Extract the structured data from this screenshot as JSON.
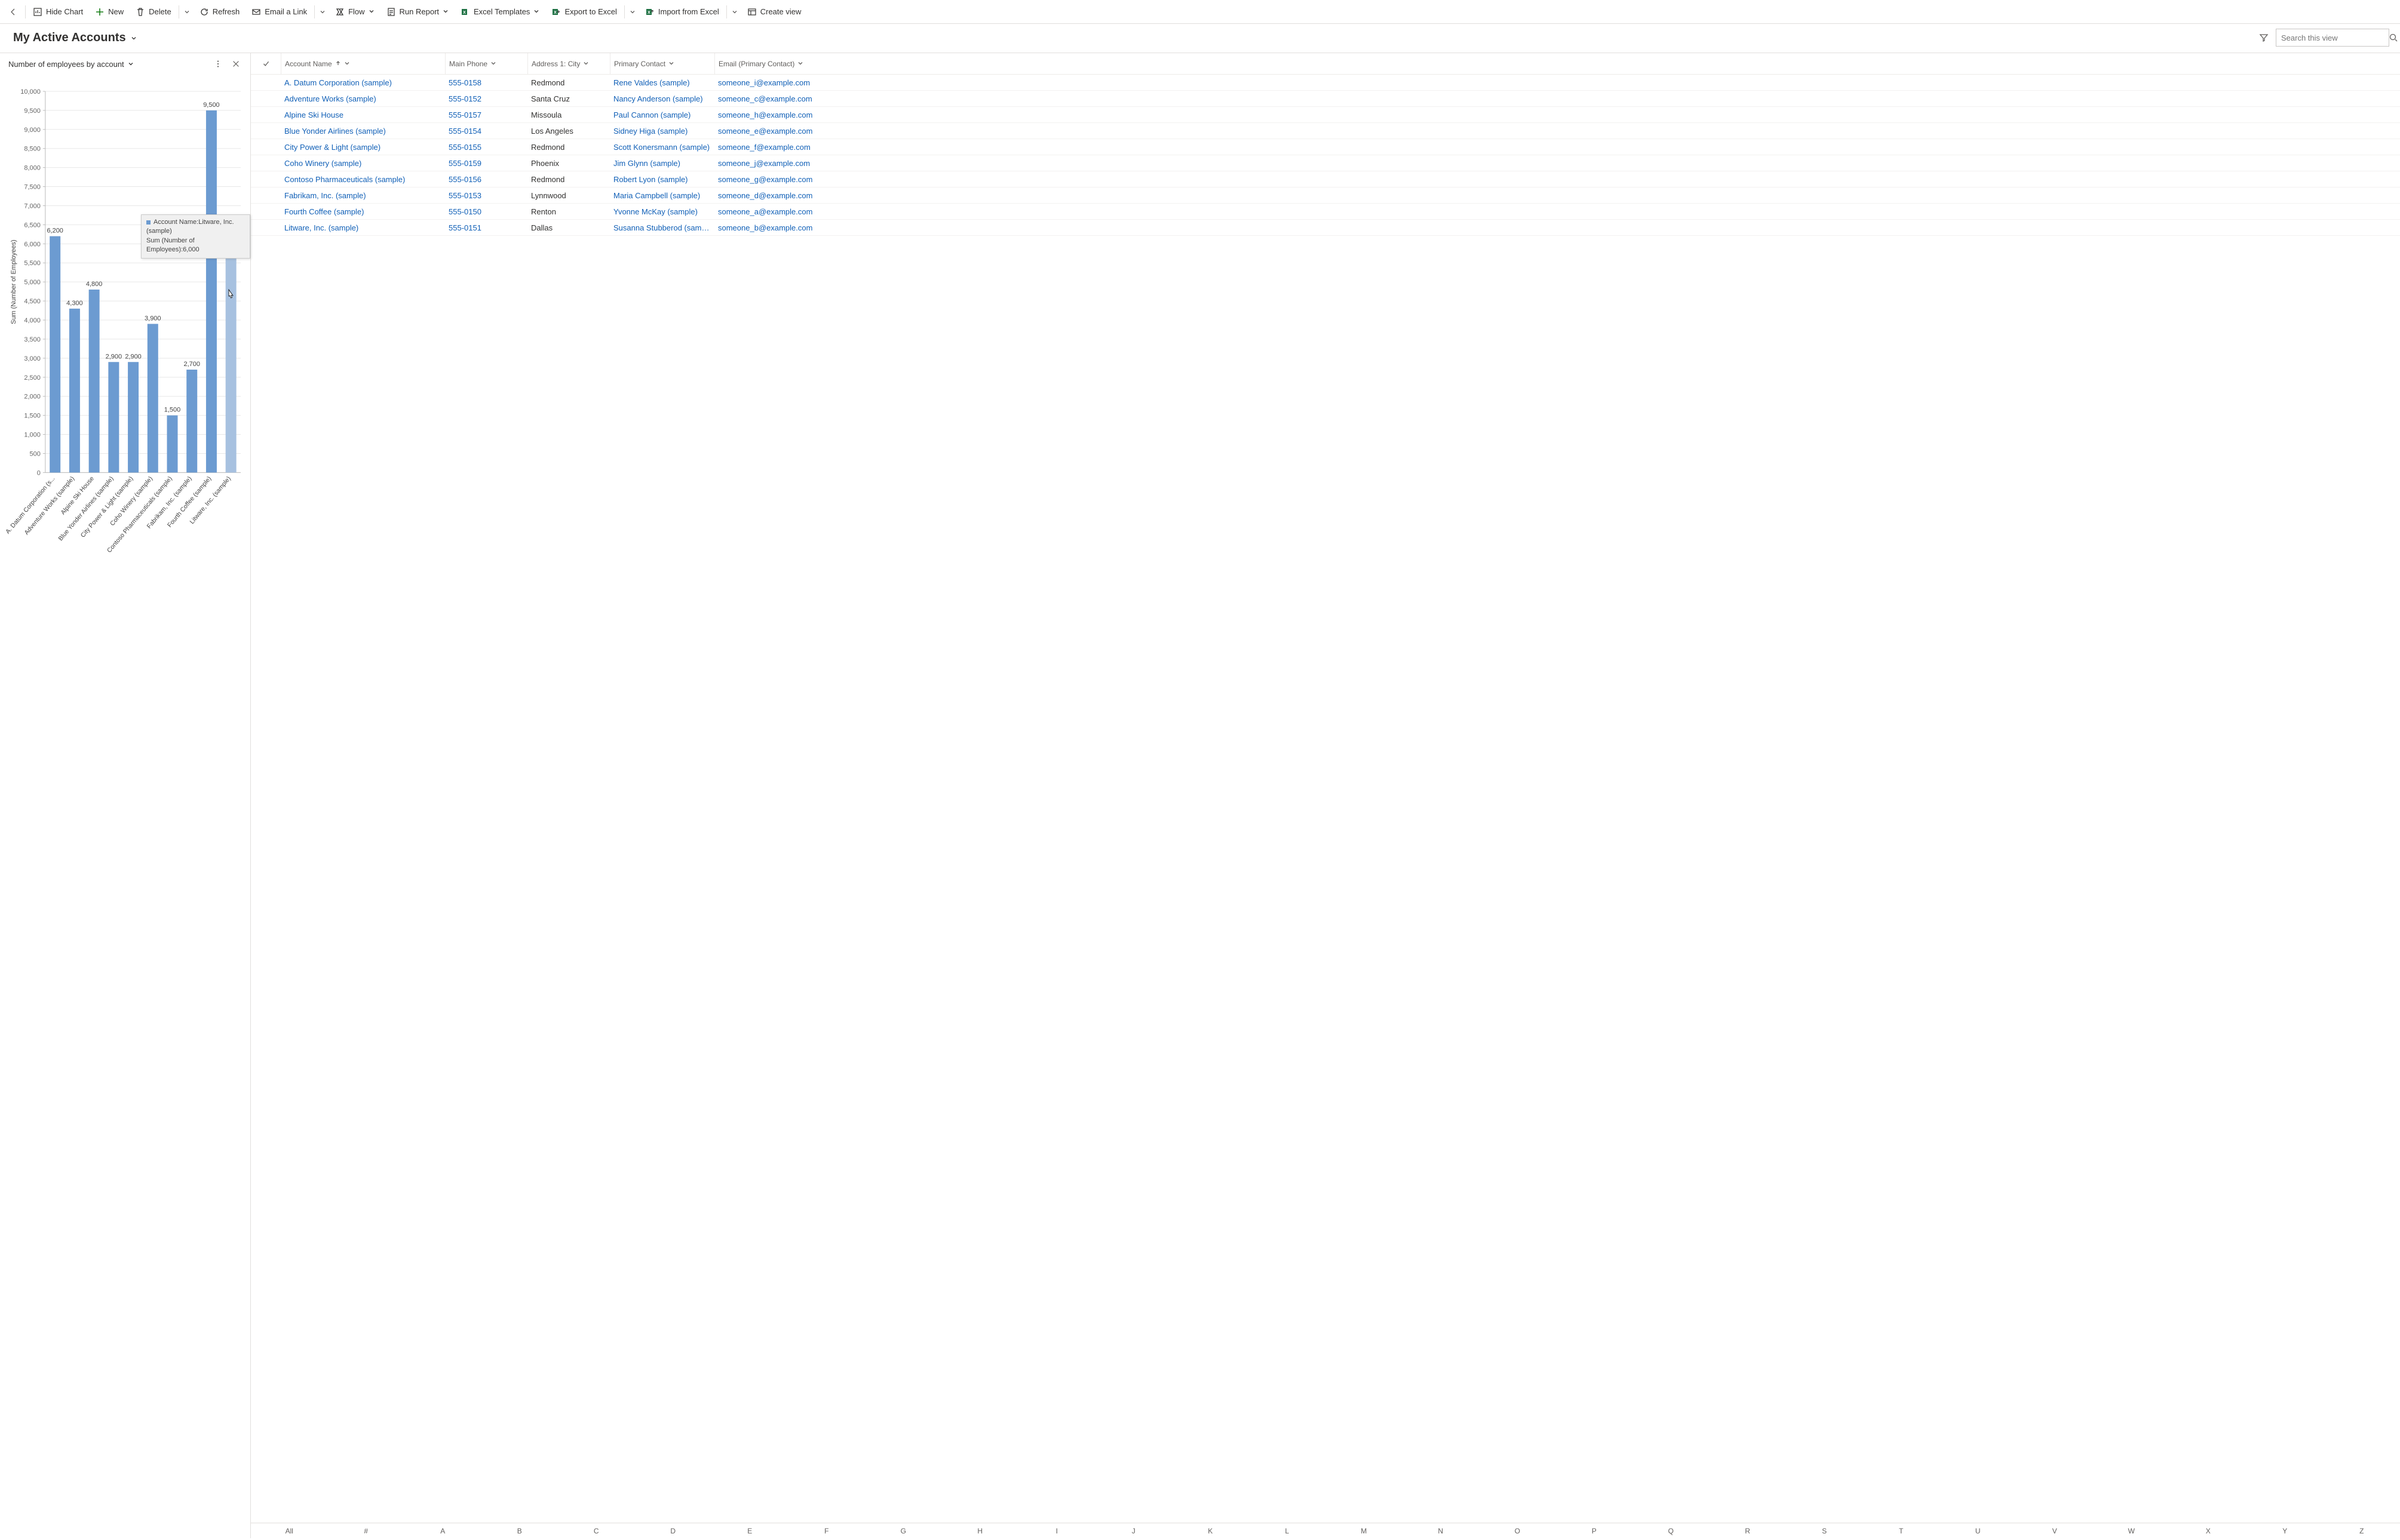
{
  "toolbar": {
    "hide_chart": "Hide Chart",
    "new": "New",
    "delete": "Delete",
    "refresh": "Refresh",
    "email_link": "Email a Link",
    "flow": "Flow",
    "run_report": "Run Report",
    "excel_templates": "Excel Templates",
    "export_excel": "Export to Excel",
    "import_excel": "Import from Excel",
    "create_view": "Create view"
  },
  "view": {
    "title": "My Active Accounts",
    "search_placeholder": "Search this view"
  },
  "chart": {
    "title": "Number of employees by account",
    "tooltip_line1": "Account Name:Litware, Inc. (sample)",
    "tooltip_line2": "Sum (Number of Employees):6,000"
  },
  "chart_data": {
    "type": "bar",
    "ylabel": "Sum (Number of Employees)",
    "ylim": [
      0,
      10000
    ],
    "ytick_step": 500,
    "categories": [
      "A. Datum Corporation (s...",
      "Adventure Works (sample)",
      "Alpine Ski House",
      "Blue Yonder Airlines (sample)",
      "City Power & Light (sample)",
      "Coho Winery (sample)",
      "Contoso Pharmaceuticals (sample)",
      "Fabrikam, Inc. (sample)",
      "Fourth Coffee (sample)",
      "Litware, Inc. (sample)"
    ],
    "values": [
      6200,
      4300,
      4800,
      2900,
      2900,
      3900,
      1500,
      2700,
      9500,
      6000
    ],
    "value_labels": [
      "6,200",
      "4,300",
      "4,800",
      "2,900",
      "2,900",
      "3,900",
      "1,500",
      "2,700",
      "9,500",
      "6,000"
    ],
    "hover_index": 9
  },
  "columns": {
    "name": "Account Name",
    "phone": "Main Phone",
    "city": "Address 1: City",
    "contact": "Primary Contact",
    "email": "Email (Primary Contact)"
  },
  "rows": [
    {
      "name": "A. Datum Corporation (sample)",
      "phone": "555-0158",
      "city": "Redmond",
      "contact": "Rene Valdes (sample)",
      "email": "someone_i@example.com"
    },
    {
      "name": "Adventure Works (sample)",
      "phone": "555-0152",
      "city": "Santa Cruz",
      "contact": "Nancy Anderson (sample)",
      "email": "someone_c@example.com"
    },
    {
      "name": "Alpine Ski House",
      "phone": "555-0157",
      "city": "Missoula",
      "contact": "Paul Cannon (sample)",
      "email": "someone_h@example.com"
    },
    {
      "name": "Blue Yonder Airlines (sample)",
      "phone": "555-0154",
      "city": "Los Angeles",
      "contact": "Sidney Higa (sample)",
      "email": "someone_e@example.com"
    },
    {
      "name": "City Power & Light (sample)",
      "phone": "555-0155",
      "city": "Redmond",
      "contact": "Scott Konersmann (sample)",
      "email": "someone_f@example.com"
    },
    {
      "name": "Coho Winery (sample)",
      "phone": "555-0159",
      "city": "Phoenix",
      "contact": "Jim Glynn (sample)",
      "email": "someone_j@example.com"
    },
    {
      "name": "Contoso Pharmaceuticals (sample)",
      "phone": "555-0156",
      "city": "Redmond",
      "contact": "Robert Lyon (sample)",
      "email": "someone_g@example.com"
    },
    {
      "name": "Fabrikam, Inc. (sample)",
      "phone": "555-0153",
      "city": "Lynnwood",
      "contact": "Maria Campbell (sample)",
      "email": "someone_d@example.com"
    },
    {
      "name": "Fourth Coffee (sample)",
      "phone": "555-0150",
      "city": "Renton",
      "contact": "Yvonne McKay (sample)",
      "email": "someone_a@example.com"
    },
    {
      "name": "Litware, Inc. (sample)",
      "phone": "555-0151",
      "city": "Dallas",
      "contact": "Susanna Stubberod (sample)",
      "email": "someone_b@example.com"
    }
  ],
  "alpha": [
    "All",
    "#",
    "A",
    "B",
    "C",
    "D",
    "E",
    "F",
    "G",
    "H",
    "I",
    "J",
    "K",
    "L",
    "M",
    "N",
    "O",
    "P",
    "Q",
    "R",
    "S",
    "T",
    "U",
    "V",
    "W",
    "X",
    "Y",
    "Z"
  ]
}
